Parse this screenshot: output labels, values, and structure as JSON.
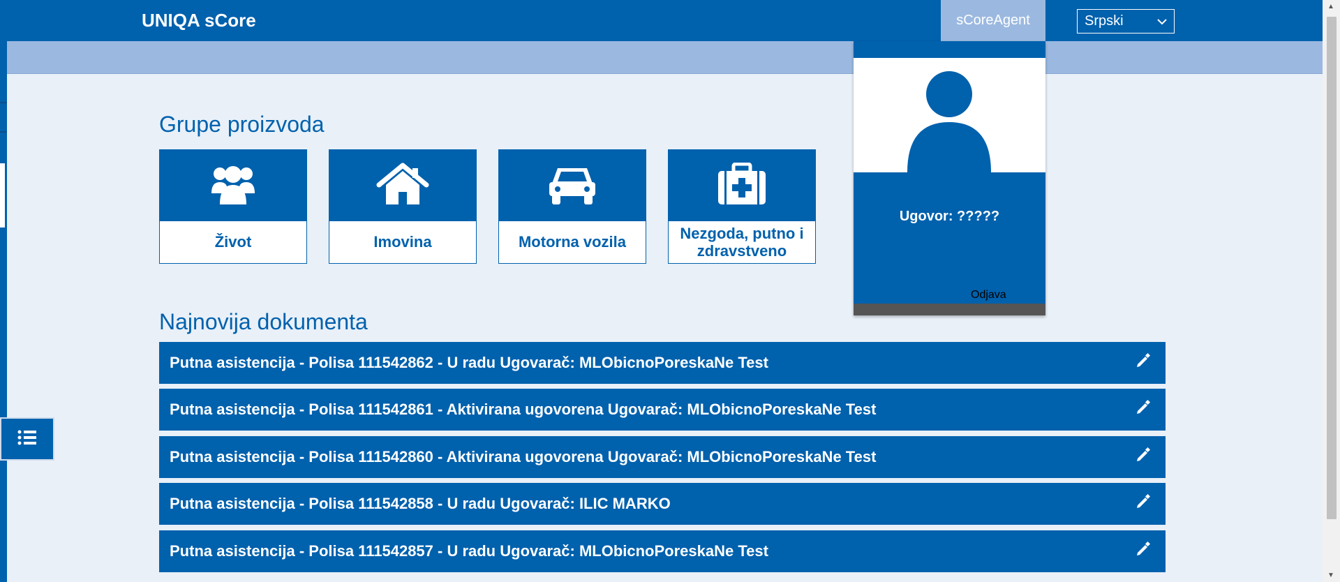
{
  "header": {
    "brand": "UNIQA sCore",
    "agent_tab": "sCoreAgent",
    "language": {
      "selected": "Srpski"
    }
  },
  "products": {
    "title": "Grupe proizvoda",
    "items": [
      {
        "label": "Život",
        "icon": "users-icon"
      },
      {
        "label": "Imovina",
        "icon": "house-icon"
      },
      {
        "label": "Motorna vozila",
        "icon": "car-icon"
      },
      {
        "label": "Nezgoda, putno i zdravstveno",
        "icon": "first-aid-kit-icon"
      }
    ]
  },
  "profile": {
    "contract": "Ugovor: ?????",
    "logout": "Odjava"
  },
  "documents": {
    "title": "Najnovija dokumenta",
    "items": [
      {
        "text": "Putna asistencija - Polisa 111542862 - U radu Ugovarač: MLObicnoPoreskaNe Test"
      },
      {
        "text": "Putna asistencija - Polisa 111542861 - Aktivirana ugovorena Ugovarač: MLObicnoPoreskaNe Test"
      },
      {
        "text": "Putna asistencija - Polisa 111542860 - Aktivirana ugovorena Ugovarač: MLObicnoPoreskaNe Test"
      },
      {
        "text": "Putna asistencija - Polisa 111542858 - U radu Ugovarač: ILIC MARKO"
      },
      {
        "text": "Putna asistencija - Polisa 111542857 - U radu Ugovarač: MLObicnoPoreskaNe Test"
      }
    ]
  },
  "colors": {
    "primary": "#0061ad",
    "light_band": "#9bb9e0",
    "background": "#e9f0f8"
  }
}
